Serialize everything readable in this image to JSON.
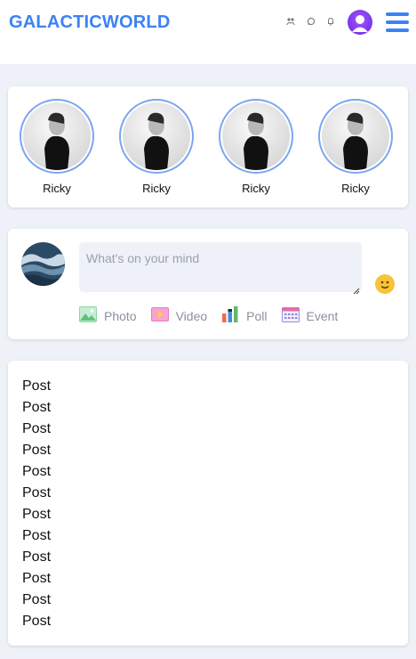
{
  "header": {
    "brand": "GALACTICWORLD",
    "icons": [
      "users-icon",
      "chat-icon",
      "bell-icon",
      "profile-avatar-icon",
      "menu-icon"
    ]
  },
  "stories": [
    {
      "name": "Ricky"
    },
    {
      "name": "Ricky"
    },
    {
      "name": "Ricky"
    },
    {
      "name": "Ricky"
    }
  ],
  "composer": {
    "placeholder": "What's on your mind",
    "value": "",
    "actions": [
      {
        "label": "Photo",
        "icon": "photo-icon"
      },
      {
        "label": "Video",
        "icon": "video-icon"
      },
      {
        "label": "Poll",
        "icon": "poll-icon"
      },
      {
        "label": "Event",
        "icon": "calendar-icon"
      }
    ]
  },
  "feed": {
    "posts": [
      "Post",
      "Post",
      "Post",
      "Post",
      "Post",
      "Post",
      "Post",
      "Post",
      "Post",
      "Post",
      "Post",
      "Post"
    ]
  },
  "colors": {
    "brand": "#3b82f6",
    "background": "#eef1f7",
    "story_ring": "#7aa6f0"
  }
}
